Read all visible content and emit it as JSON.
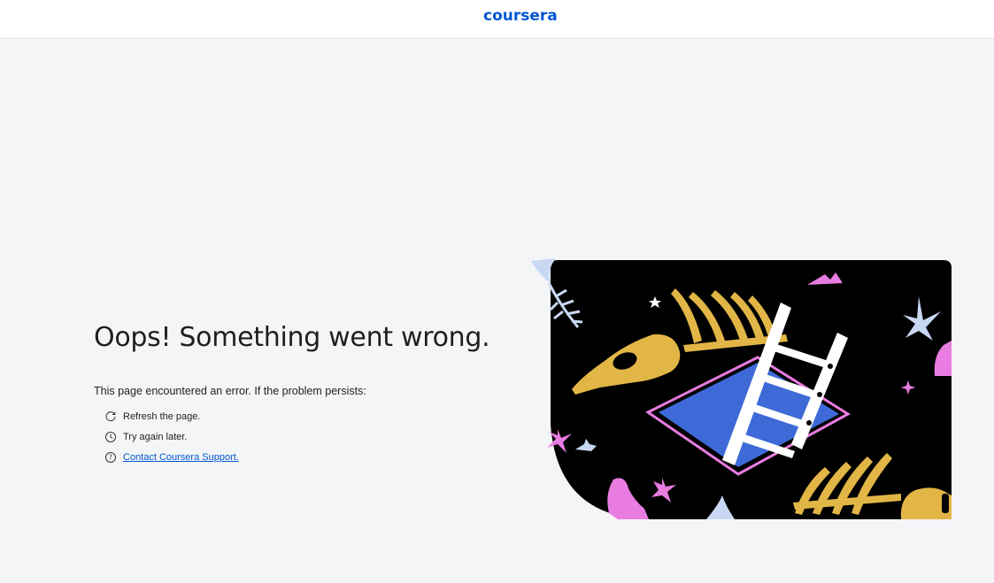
{
  "header": {
    "logo_text": "coursera",
    "brand_color": "#0056d2"
  },
  "error": {
    "title": "Oops! Something went wrong.",
    "description": "This page encountered an error. If the problem persists:",
    "suggestions": [
      {
        "icon": "refresh-icon",
        "text": "Refresh the page."
      },
      {
        "icon": "clock-icon",
        "text": "Try again later."
      },
      {
        "icon": "help-circle-icon",
        "text": "Contact Coursera Support."
      }
    ]
  },
  "illustration": {
    "subject": "skeleton-in-pit-with-ladder",
    "colors": {
      "background": "#000000",
      "bones": "#e2b646",
      "pit": "#3d6ad6",
      "accent_pink": "#e97ce0",
      "accent_light": "#c9d8f2"
    }
  }
}
